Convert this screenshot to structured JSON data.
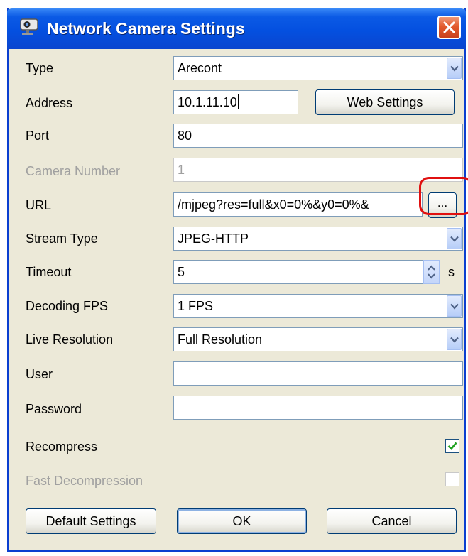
{
  "window": {
    "title": "Network Camera Settings",
    "title_icon": "camera-icon",
    "close_icon": "close-icon"
  },
  "fields": {
    "type": {
      "label": "Type",
      "value": "Arecont"
    },
    "address": {
      "label": "Address",
      "value": "10.1.11.10",
      "web_settings_label": "Web Settings"
    },
    "port": {
      "label": "Port",
      "value": "80"
    },
    "camera_number": {
      "label": "Camera Number",
      "value": "1"
    },
    "url": {
      "label": "URL",
      "value": "/mjpeg?res=full&x0=0%&y0=0%&",
      "browse_label": "..."
    },
    "stream_type": {
      "label": "Stream Type",
      "value": "JPEG-HTTP"
    },
    "timeout": {
      "label": "Timeout",
      "value": "5",
      "unit": "s"
    },
    "decoding_fps": {
      "label": "Decoding FPS",
      "value": "1 FPS"
    },
    "live_resolution": {
      "label": "Live Resolution",
      "value": "Full Resolution"
    },
    "user": {
      "label": "User",
      "value": ""
    },
    "password": {
      "label": "Password",
      "value": ""
    },
    "recompress": {
      "label": "Recompress",
      "checked": true
    },
    "fast_decompression": {
      "label": "Fast Decompression",
      "checked": false
    }
  },
  "buttons": {
    "default_settings": "Default Settings",
    "ok": "OK",
    "cancel": "Cancel"
  },
  "colors": {
    "title_bar": "#0450e0",
    "dialog_bg": "#ece9d8",
    "highlight_circle": "#e01010"
  }
}
